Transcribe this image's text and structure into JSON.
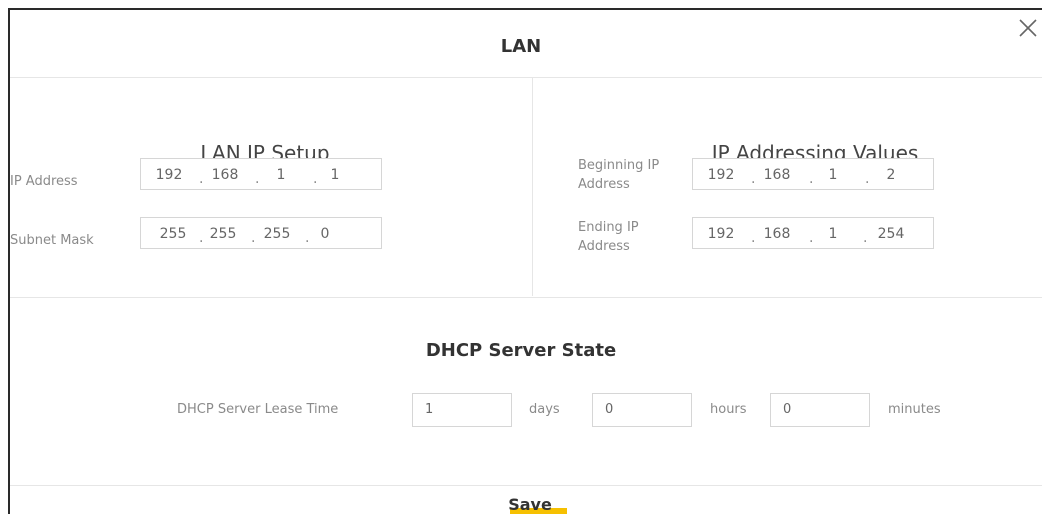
{
  "dialog": {
    "title": "LAN",
    "close_icon": "close-icon"
  },
  "lan_ip_setup": {
    "title": "LAN IP Setup",
    "ip_address_label": "IP Address",
    "ip_address": [
      "192",
      "168",
      "1",
      "1"
    ],
    "subnet_mask_label": "Subnet Mask",
    "subnet_mask": [
      "255",
      "255",
      "255",
      "0"
    ]
  },
  "ip_addressing_values": {
    "title": "IP Addressing Values",
    "beginning_label_line1": "Beginning IP",
    "beginning_label_line2": "Address",
    "beginning_ip": [
      "192",
      "168",
      "1",
      "2"
    ],
    "ending_label_line1": "Ending IP",
    "ending_label_line2": "Address",
    "ending_ip": [
      "192",
      "168",
      "1",
      "254"
    ]
  },
  "dhcp": {
    "title": "DHCP Server State",
    "lease_label": "DHCP Server Lease Time",
    "days_value": "1",
    "days_unit": "days",
    "hours_value": "0",
    "hours_unit": "hours",
    "minutes_value": "0",
    "minutes_unit": "minutes"
  },
  "footer": {
    "save_label": "Save",
    "accent_color": "#f6c000"
  }
}
